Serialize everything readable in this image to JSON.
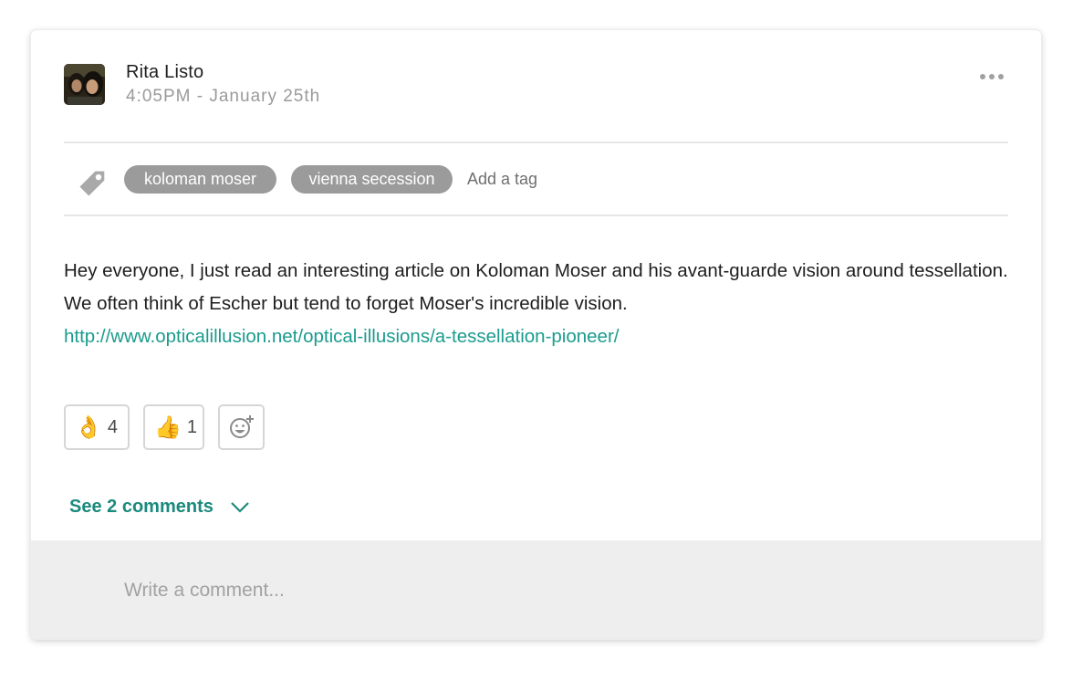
{
  "post": {
    "author": "Rita Listo",
    "timestamp": "4:05PM - January 25th",
    "tags": [
      "koloman moser",
      "vienna secession"
    ],
    "add_tag_label": "Add a tag",
    "body": "Hey everyone, I just read an interesting article on Koloman Moser and his avant-guarde vision around tessellation. We often think of Escher but tend to forget Moser's incredible vision.",
    "link": "http://www.opticalillusion.net/optical-illusions/a-tessellation-pioneer/",
    "reactions": [
      {
        "emoji": "👌",
        "icon": "ok-hand-icon",
        "count": "4"
      },
      {
        "emoji": "👍",
        "icon": "thumbs-up-icon",
        "count": "1"
      }
    ],
    "add_reaction_icon": "add-emoji-icon",
    "see_comments_label": "See 2 comments",
    "comment_placeholder": "Write a comment..."
  },
  "colors": {
    "accent": "#1b9c8e",
    "tag_chip": "#9b9b9b",
    "reaction_emoji": "#f5c33b"
  }
}
